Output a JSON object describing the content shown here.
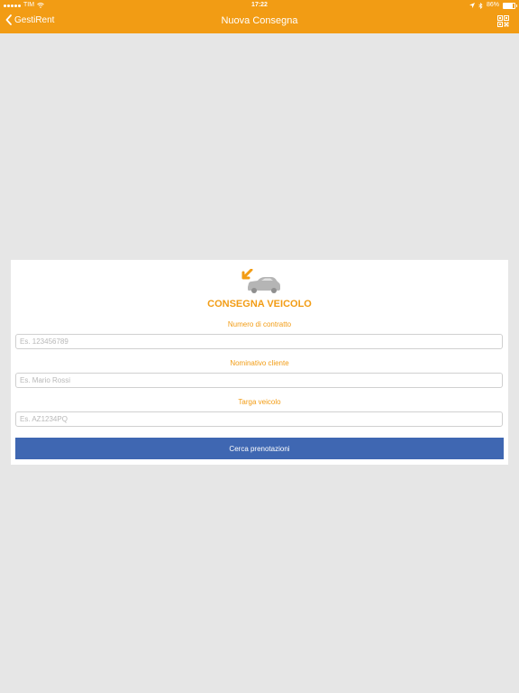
{
  "status_bar": {
    "carrier": "TIM",
    "time": "17:22",
    "battery": "86%",
    "battery_level": 0.86
  },
  "nav": {
    "back_label": "GestiRent",
    "title": "Nuova Consegna",
    "qr_icon": "qr-code-icon"
  },
  "form": {
    "title": "CONSEGNA VEICOLO",
    "icon": "car-delivery-icon",
    "fields": [
      {
        "label": "Numero di contratto",
        "placeholder": "Es. 123456789",
        "value": ""
      },
      {
        "label": "Nominativo cliente",
        "placeholder": "Es. Mario Rossi",
        "value": ""
      },
      {
        "label": "Targa veicolo",
        "placeholder": "Es. AZ1234PQ",
        "value": ""
      }
    ],
    "button_label": "Cerca prenotazioni"
  },
  "colors": {
    "accent": "#f29c14",
    "button": "#3f67b2",
    "background": "#e6e6e6"
  }
}
